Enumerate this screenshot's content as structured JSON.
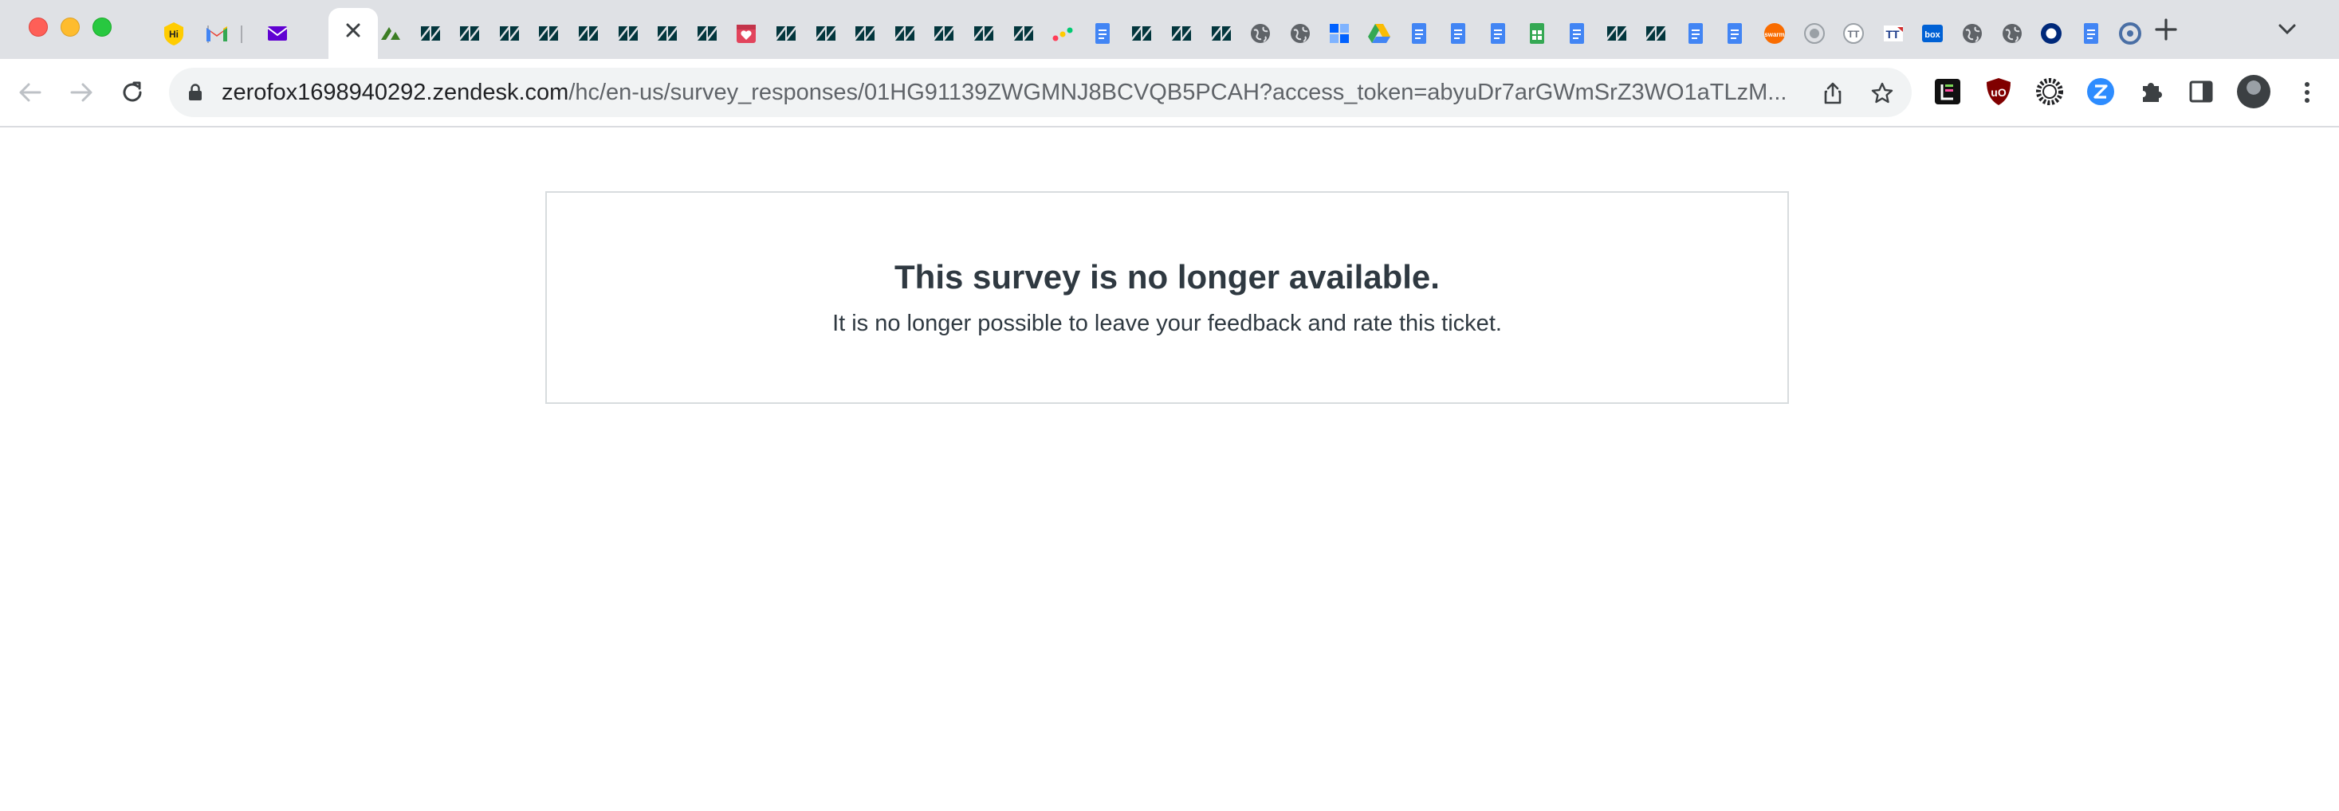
{
  "browser": {
    "tab_favicons": [
      "honey-extension-icon",
      "gmail-icon",
      "yahoo-mail-icon",
      "close-tab-icon",
      "zendesk-sell-icon",
      "zendesk-icon",
      "zendesk-icon",
      "zendesk-icon",
      "zendesk-icon",
      "zendesk-icon",
      "zendesk-icon",
      "zendesk-icon",
      "zendesk-icon",
      "calendar-heart-icon",
      "zendesk-icon",
      "zendesk-icon",
      "zendesk-icon",
      "zendesk-icon",
      "zendesk-icon",
      "zendesk-icon",
      "zendesk-icon",
      "monday-icon",
      "google-docs-icon",
      "zendesk-icon",
      "zendesk-icon",
      "zendesk-icon",
      "globe-icon",
      "globe-icon",
      "dropbox-icon",
      "google-drive-icon",
      "google-docs-icon",
      "google-docs-icon",
      "google-docs-icon",
      "google-sheets-icon",
      "google-docs-icon",
      "zendesk-icon",
      "zendesk-icon",
      "google-docs-icon",
      "google-docs-icon",
      "swarm-icon",
      "generic-circle-icon",
      "tt-icon",
      "tt-flag-icon",
      "box-icon",
      "globe-icon",
      "globe-icon",
      "okta-icon",
      "google-docs-icon",
      "ring-icon"
    ],
    "honey_label": "Hi",
    "box_label": "box",
    "tt_label": "TT",
    "address": {
      "domain": "zerofox1698940292.zendesk.com",
      "path": "/hc/en-us/survey_responses/01HG91139ZWGMNJ8BCVQB5PCAH?access_token=abyuDr7arGWmSrZ3WO1aTLzM..."
    },
    "extensions": [
      "notebook-extension-icon",
      "ublock-icon",
      "gear-extension-icon",
      "zoom-icon",
      "puzzle-icon",
      "side-panel-icon"
    ],
    "colors": {
      "tab_strip": "#dfe1e5",
      "zendesk": "#03363d",
      "google_blue": "#4285f4",
      "google_sheets": "#34a853"
    }
  },
  "page": {
    "title": "This survey is no longer available.",
    "message": "It is no longer possible to leave your feedback and rate this ticket."
  }
}
